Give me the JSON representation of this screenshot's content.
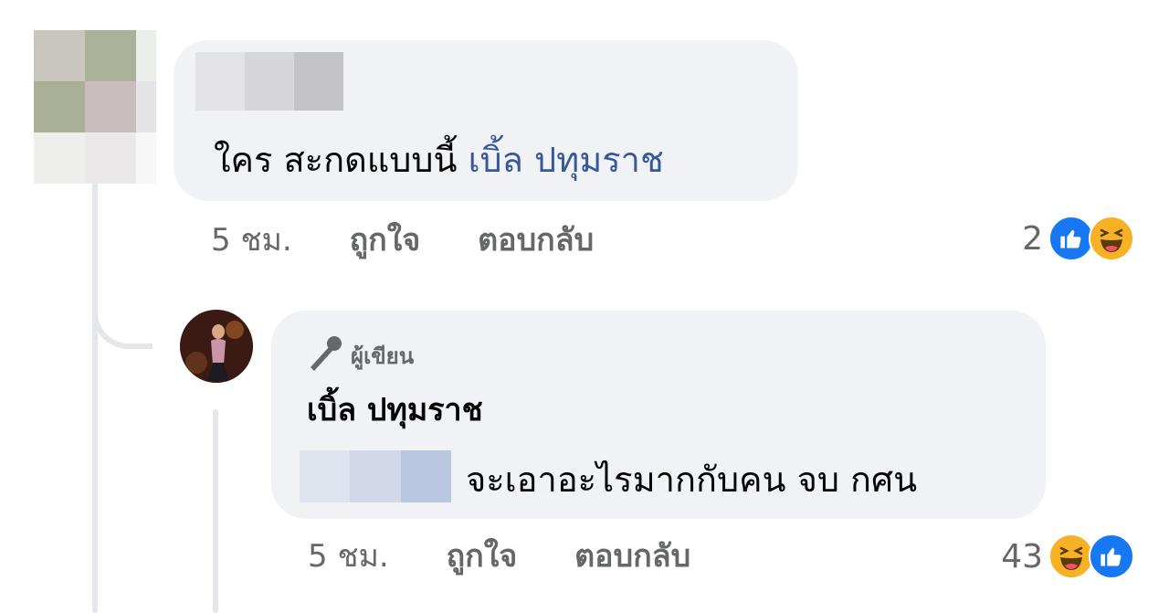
{
  "comment": {
    "text": "ใคร สะกดแบบนี้",
    "mention": "เบิ้ล ปทุมราช",
    "time": "5 ชม.",
    "like_label": "ถูกใจ",
    "reply_label": "ตอบกลับ",
    "reaction_count": "2",
    "reactions": [
      "like-icon",
      "haha-icon"
    ]
  },
  "reply": {
    "badge_label": "ผู้เขียน",
    "badge_icon": "microphone-icon",
    "author_name": "เบิ้ล ปทุมราช",
    "text": "จะเอาอะไรมากกับคน จบ กศน",
    "time": "5 ชม.",
    "like_label": "ถูกใจ",
    "reply_label": "ตอบกลับ",
    "reaction_count": "43",
    "reactions": [
      "haha-icon",
      "like-icon"
    ]
  },
  "colors": {
    "bubble_bg": "#f0f2f5",
    "mention": "#385898",
    "meta_text": "#65676b",
    "like_blue": "#1877f2",
    "haha_yellow": "#f7b125"
  }
}
